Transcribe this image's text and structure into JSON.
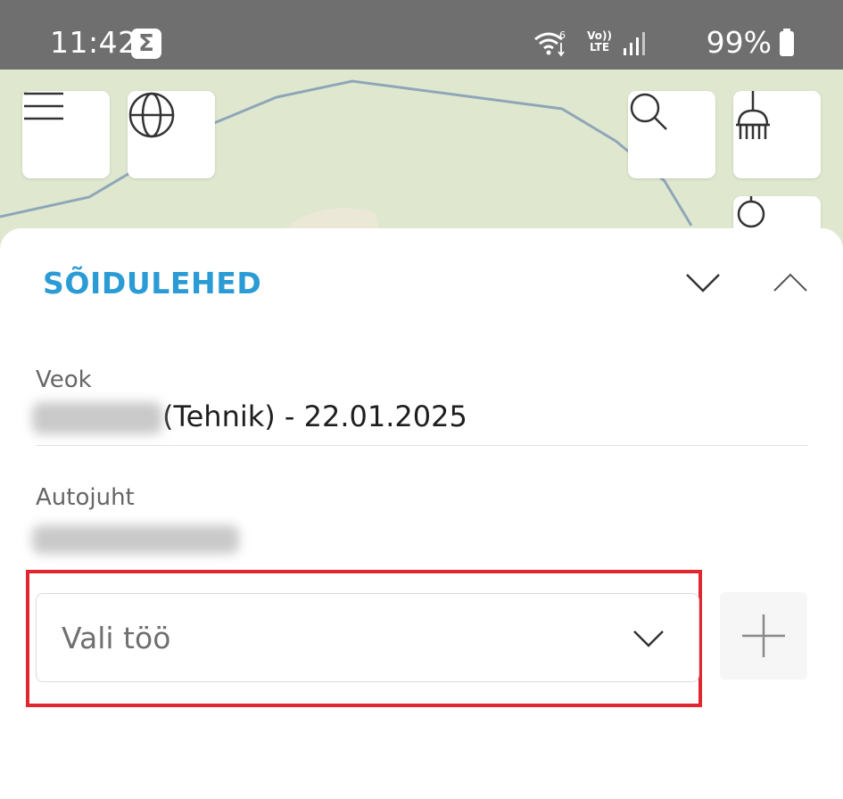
{
  "status_bar": {
    "time": "11:42",
    "battery": "99%",
    "icons": [
      "sigma-icon",
      "wifi-icon",
      "volte-icon",
      "signal-icon",
      "battery-icon"
    ]
  },
  "map": {
    "buttons": [
      "menu-icon",
      "globe-icon",
      "search-icon",
      "broom-icon",
      "compass-icon"
    ]
  },
  "sheet": {
    "title": "SÕIDULEHED",
    "vehicle": {
      "label": "Veok",
      "value": "(Tehnik) - 22.01.2025"
    },
    "driver": {
      "label": "Autojuht"
    },
    "job_select": {
      "placeholder": "Vali töö"
    }
  },
  "colors": {
    "accent": "#2a9bd4",
    "highlight": "#e0262e",
    "map_bg": "#dfe8cf",
    "status_bar": "#6f6f6f"
  }
}
